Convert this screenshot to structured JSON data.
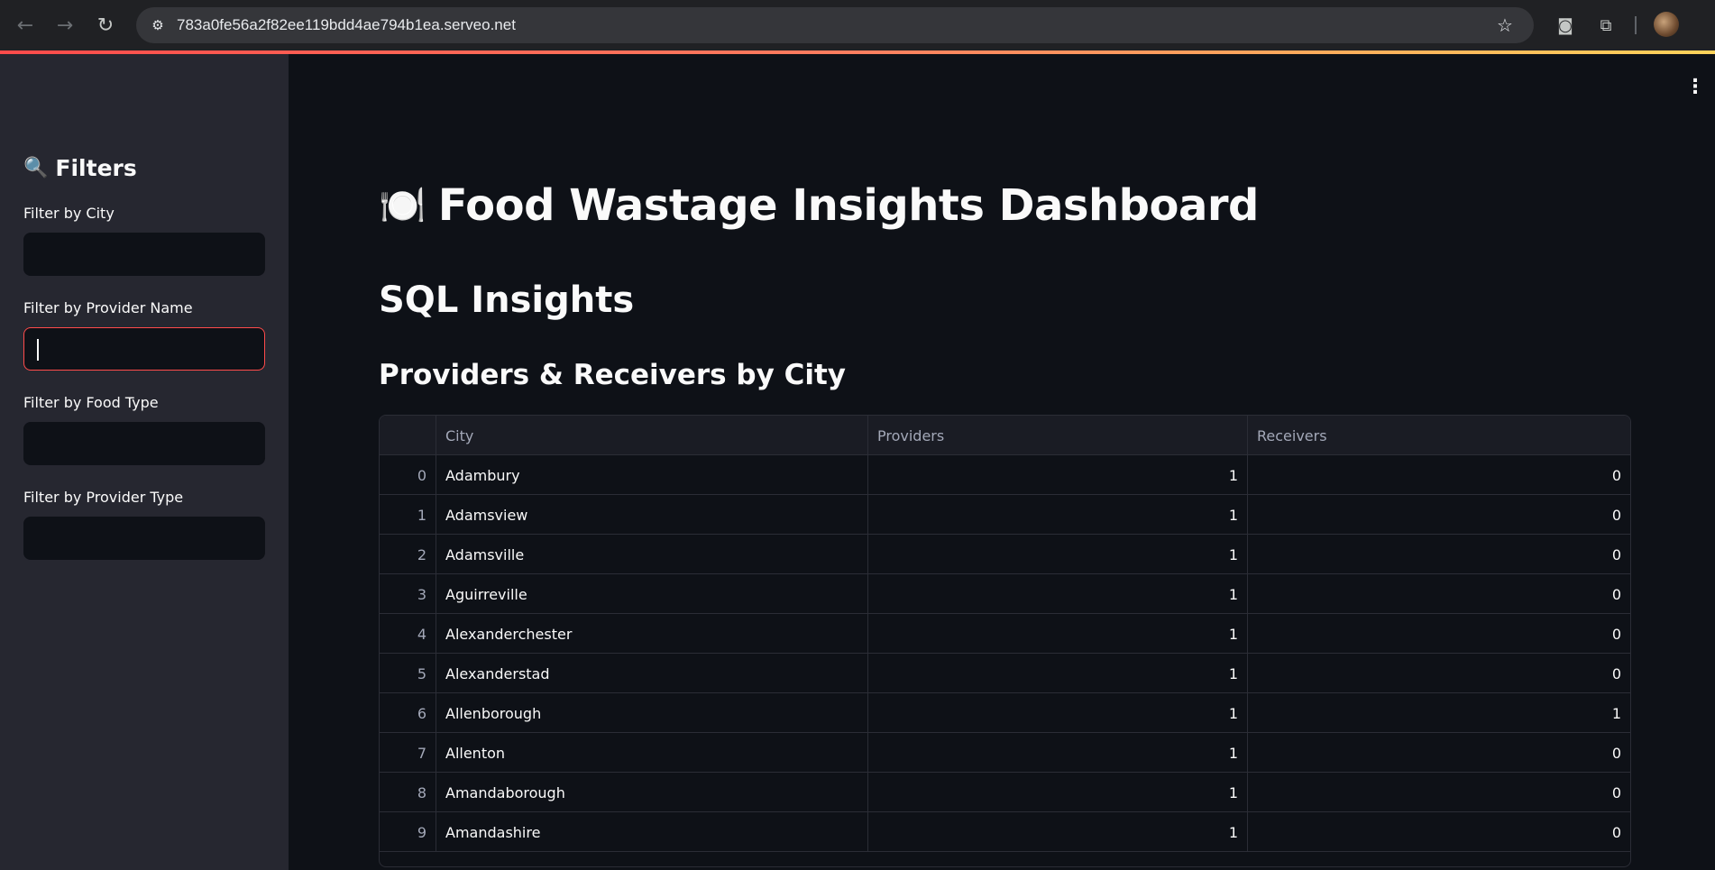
{
  "browser": {
    "url": "783a0fe56a2f82ee119bdd4ae794b1ea.serveo.net",
    "icons": {
      "back": "arrow-left-icon",
      "forward": "arrow-right-icon",
      "reload": "reload-icon",
      "site_info": "tune-icon",
      "bookmark": "star-icon",
      "screenshot": "camera-icon",
      "extensions": "puzzle-icon"
    }
  },
  "sidebar": {
    "title": "Filters",
    "title_emoji": "🔍",
    "filters": [
      {
        "label": "Filter by City",
        "value": ""
      },
      {
        "label": "Filter by Provider Name",
        "value": ""
      },
      {
        "label": "Filter by Food Type",
        "value": ""
      },
      {
        "label": "Filter by Provider Type",
        "value": ""
      }
    ]
  },
  "main": {
    "title": "Food Wastage Insights Dashboard",
    "title_emoji": "🍽️",
    "section_title": "SQL Insights",
    "table_title": "Providers & Receivers by City",
    "table": {
      "columns": [
        "",
        "City",
        "Providers",
        "Receivers"
      ],
      "rows": [
        {
          "index": "0",
          "city": "Adambury",
          "providers": "1",
          "receivers": "0"
        },
        {
          "index": "1",
          "city": "Adamsview",
          "providers": "1",
          "receivers": "0"
        },
        {
          "index": "2",
          "city": "Adamsville",
          "providers": "1",
          "receivers": "0"
        },
        {
          "index": "3",
          "city": "Aguirreville",
          "providers": "1",
          "receivers": "0"
        },
        {
          "index": "4",
          "city": "Alexanderchester",
          "providers": "1",
          "receivers": "0"
        },
        {
          "index": "5",
          "city": "Alexanderstad",
          "providers": "1",
          "receivers": "0"
        },
        {
          "index": "6",
          "city": "Allenborough",
          "providers": "1",
          "receivers": "1"
        },
        {
          "index": "7",
          "city": "Allenton",
          "providers": "1",
          "receivers": "0"
        },
        {
          "index": "8",
          "city": "Amandaborough",
          "providers": "1",
          "receivers": "0"
        },
        {
          "index": "9",
          "city": "Amandashire",
          "providers": "1",
          "receivers": "0"
        }
      ]
    }
  },
  "colors": {
    "accent": "#ff4b4b",
    "background": "#0e1117",
    "sidebar": "#262730"
  }
}
